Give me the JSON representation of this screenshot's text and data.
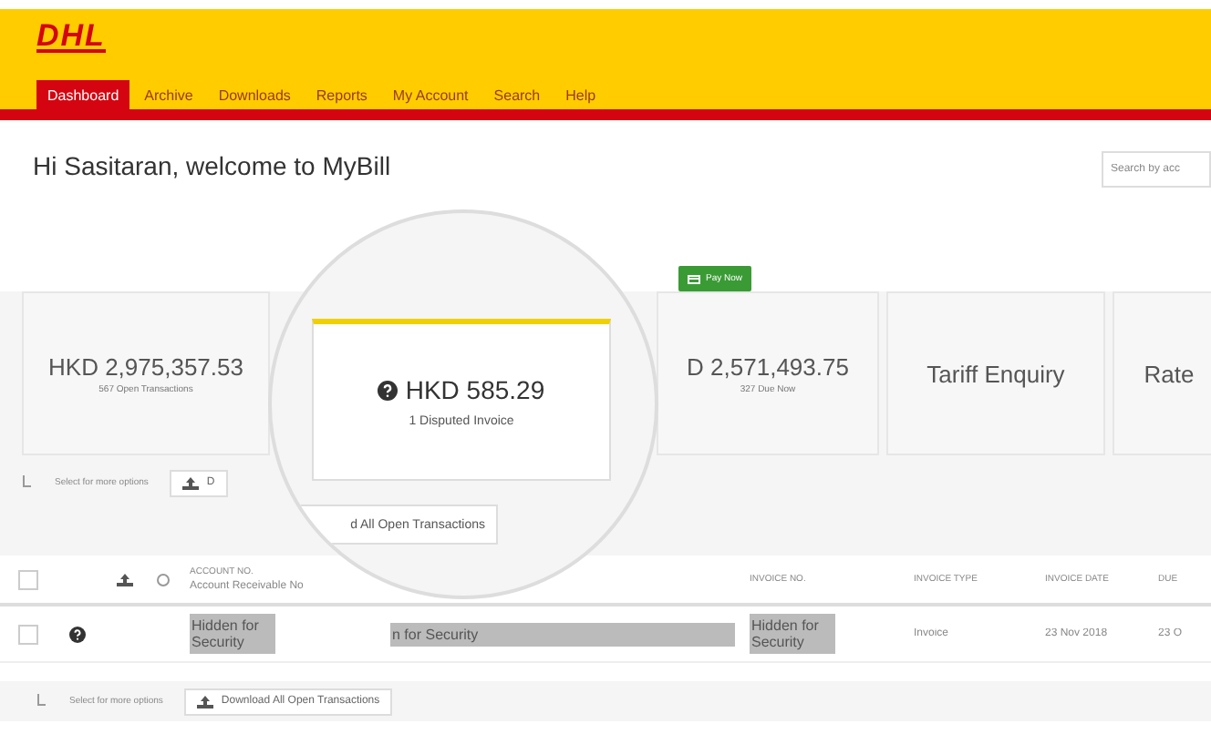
{
  "logo": "DHL",
  "nav": [
    {
      "label": "Dashboard",
      "selected": true
    },
    {
      "label": "Archive",
      "selected": false
    },
    {
      "label": "Downloads",
      "selected": false
    },
    {
      "label": "Reports",
      "selected": false
    },
    {
      "label": "My Account",
      "selected": false
    },
    {
      "label": "Search",
      "selected": false
    },
    {
      "label": "Help",
      "selected": false
    }
  ],
  "greeting": "Hi Sasitaran, welcome to MyBill",
  "search": {
    "placeholder": "Search by acc"
  },
  "cards": [
    {
      "kind": "amount",
      "amount": "HKD 2,975,357.53",
      "caption": "567 Open Transactions"
    },
    {
      "kind": "hidden"
    },
    {
      "kind": "amount",
      "amount": "D 2,571,493.75",
      "caption": "327 Due Now",
      "badge": "Pay Now"
    },
    {
      "kind": "title",
      "title": "Tariff Enquiry"
    },
    {
      "kind": "title",
      "title": "Rate"
    }
  ],
  "toolbar": {
    "hint": "Select for more options",
    "button": "D"
  },
  "magnifier": {
    "amount": "HKD 585.29",
    "caption": "1 Disputed Invoice",
    "button": "d All Open Transactions"
  },
  "table": {
    "columns": [
      {
        "label": "ACCOUNT NO.",
        "sublabel": "Account Receivable No"
      },
      {},
      {
        "label": "INVOICE NO."
      },
      {
        "label": "INVOICE TYPE"
      },
      {
        "label": "INVOICE DATE"
      },
      {
        "label": "DUE"
      }
    ],
    "header_checked": false,
    "rows": [
      {
        "checked": false,
        "cells": [
          {
            "text": "Hidden for Security",
            "masked": true
          },
          {
            "text": "n for Security",
            "masked": true
          },
          {
            "text": "Hidden for Security",
            "masked": true
          },
          {
            "text": "Invoice",
            "masked": false
          },
          {
            "text": "23 Nov 2018",
            "masked": false
          },
          {
            "text": "23 O",
            "masked": false
          }
        ]
      }
    ]
  },
  "footer_toolbar": {
    "hint": "Select for more options",
    "button": "Download All Open Transactions"
  }
}
